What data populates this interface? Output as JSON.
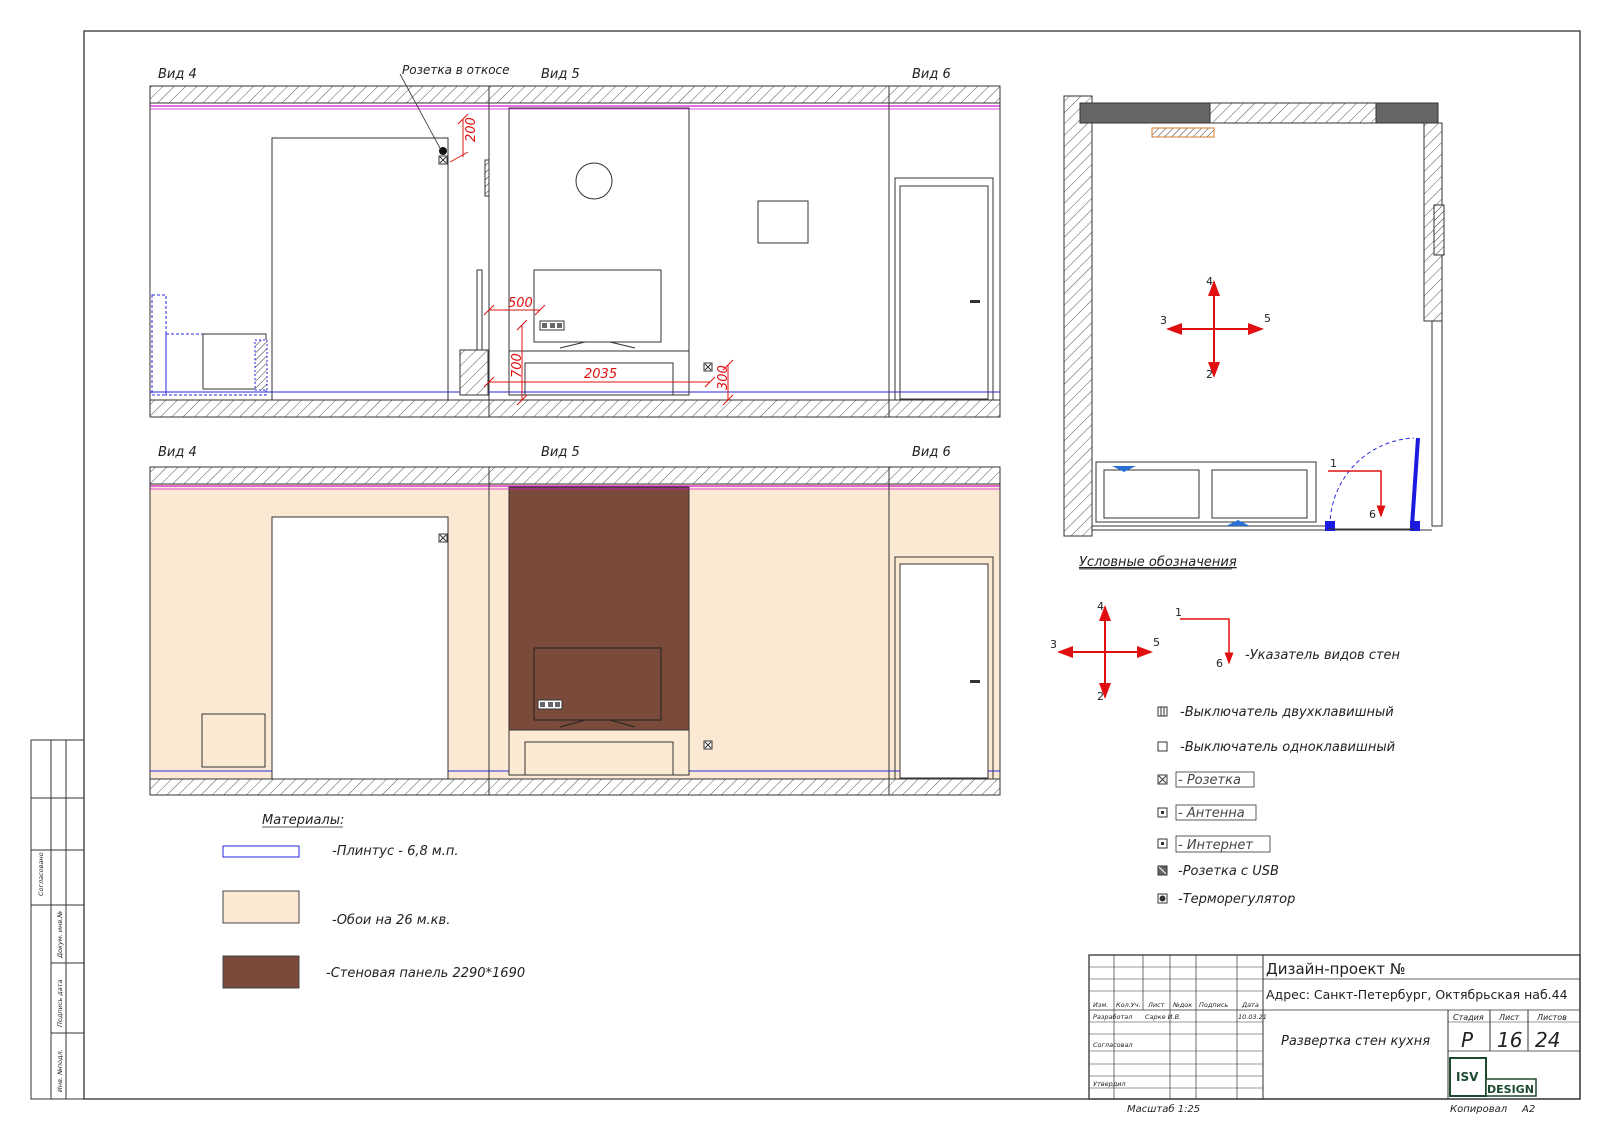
{
  "views": {
    "elev_top": {
      "v4": "Вид 4",
      "v5": "Вид 5",
      "v6": "Вид 6",
      "socket_note": "Розетка в откосе"
    },
    "elev_bottom": {
      "v4": "Вид 4",
      "v5": "Вид 5",
      "v6": "Вид 6"
    }
  },
  "dimensions": {
    "d200": "200",
    "d500": "500",
    "d700": "700",
    "d2035": "2035",
    "d300": "300"
  },
  "plan": {
    "arrows": {
      "n4": "4",
      "n3": "3",
      "n5": "5",
      "n2": "2",
      "n1": "1",
      "n6": "6"
    }
  },
  "legend": {
    "title": "Условные обозначения",
    "arrows": {
      "n4": "4",
      "n3": "3",
      "n5": "5",
      "n2": "2",
      "n1": "1",
      "n6": "6"
    },
    "view_pointer": "-Указатель видов стен",
    "items": [
      {
        "label": "-Выключатель двухклавишный",
        "icon": "double-switch-icon",
        "boxed": false
      },
      {
        "label": "-Выключатель одноклавишный",
        "icon": "single-switch-icon",
        "boxed": false
      },
      {
        "label": "- Розетка",
        "icon": "socket-icon",
        "boxed": true
      },
      {
        "label": "- Антенна",
        "icon": "antenna-icon",
        "boxed": true
      },
      {
        "label": "- Интернет",
        "icon": "internet-icon",
        "boxed": true
      },
      {
        "label": "-Розетка с USB",
        "icon": "usb-socket-icon",
        "boxed": false
      },
      {
        "label": "-Терморегулятор",
        "icon": "thermostat-icon",
        "boxed": false
      }
    ]
  },
  "materials": {
    "title": "Материалы:",
    "items": [
      {
        "label": "-Плинтус - 6,8 м.п.",
        "swatch": "#ffffff",
        "stroke": "#2a2ae0"
      },
      {
        "label": "-Обои на 26 м.кв.",
        "swatch": "#fbe9d4",
        "stroke": "#444444"
      },
      {
        "label": "-Стеновая панель 2290*1690",
        "swatch": "#7a4b3a",
        "stroke": "#444444"
      }
    ]
  },
  "side_stamp": {
    "agreed": "Согласовано",
    "doc": "Докум. инв.№",
    "sign": "Подпись дата",
    "inv": "Инв. №подл."
  },
  "title_block": {
    "project": "Дизайн-проект №",
    "address": "Адрес: Санкт-Петербург, Октябрьская наб.44",
    "headers": {
      "izm": "Изм.",
      "kol": "Кол.Уч.",
      "list": "Лист",
      "ndoc": "№док",
      "podp": "Подпись",
      "data": "Дата"
    },
    "developed": "Разработал",
    "developer": "Сарке И.В.",
    "date": "10.03.21",
    "agreed": "Согласовал",
    "approved": "Утвердил",
    "sheet_title": "Развертка стен кухня",
    "stage_label": "Стадия",
    "stage": "Р",
    "sheet_label": "Лист",
    "sheet": "16",
    "sheets_label": "Листов",
    "sheets": "24",
    "logo_isv": "ISV",
    "logo_design": "DESIGN",
    "scale": "Масштаб 1:25",
    "copied": "Копировал",
    "format": "А2"
  },
  "colors": {
    "wallpaper": "#fbe9d4",
    "panel": "#7a4b3a",
    "arrow": "#e01010",
    "plinth": "#2a2ae0",
    "ceiling_line": "#d21ad2",
    "dim_red": "#e01010"
  }
}
